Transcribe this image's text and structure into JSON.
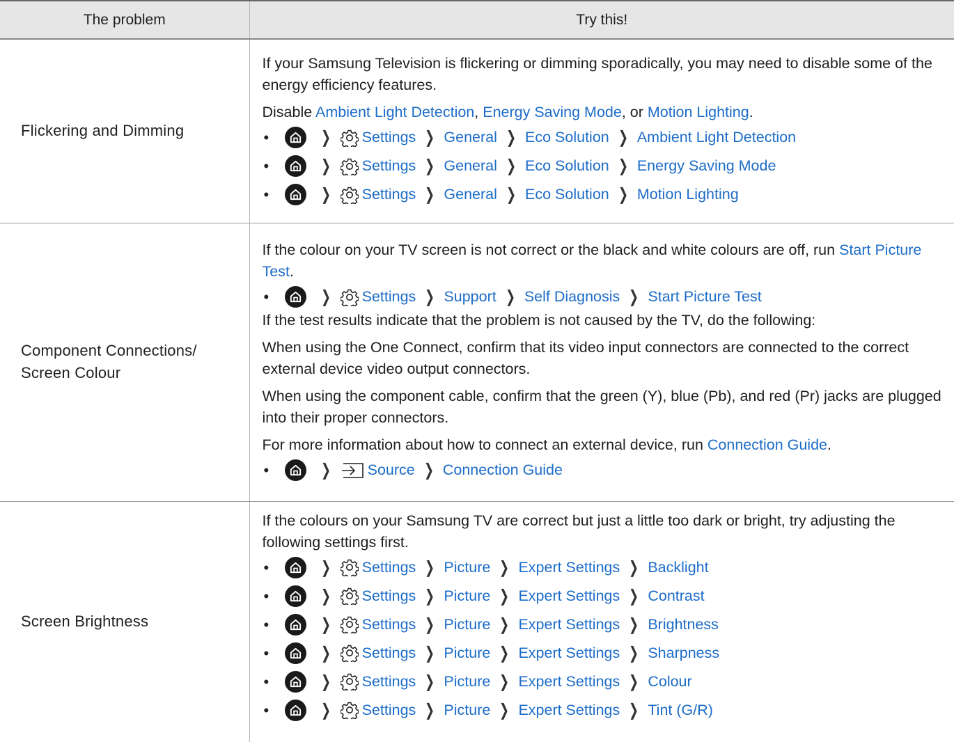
{
  "table": {
    "headers": [
      "The problem",
      "Try this!"
    ],
    "rows": [
      {
        "problem": "Flickering and Dimming",
        "p1": "If your Samsung Television is flickering or dimming sporadically, you may need to disable some of the energy efficiency features.",
        "p2_prefix": "Disable ",
        "p2_link1": "Ambient Light Detection",
        "p2_sep1": ", ",
        "p2_link2": "Energy Saving Mode",
        "p2_sep2": ", or ",
        "p2_link3": "Motion Lighting",
        "p2_end": ".",
        "paths": [
          [
            "Settings",
            "General",
            "Eco Solution",
            "Ambient Light Detection"
          ],
          [
            "Settings",
            "General",
            "Eco Solution",
            "Energy Saving Mode"
          ],
          [
            "Settings",
            "General",
            "Eco Solution",
            "Motion Lighting"
          ]
        ]
      },
      {
        "problem_line1": "Component Connections/",
        "problem_line2": "Screen Colour",
        "p1_text": "If the colour on your TV screen is not correct or the black and white colours are off, run ",
        "p1_link": "Start Picture Test",
        "p1_end": ".",
        "path1": [
          "Settings",
          "Support",
          "Self Diagnosis",
          "Start Picture Test"
        ],
        "p2": "If the test results indicate that the problem is not caused by the TV, do the following:",
        "p3": "When using the One Connect, confirm that its video input connectors are connected to the correct external device video output connectors.",
        "p4": "When using the component cable, confirm that the green (Y), blue (Pb), and red (Pr) jacks are plugged into their proper connectors.",
        "p5_text": "For more information about how to connect an external device, run ",
        "p5_link": "Connection Guide",
        "p5_end": ".",
        "path2": [
          "Source",
          "Connection Guide"
        ]
      },
      {
        "problem": "Screen Brightness",
        "p1": "If the colours on your Samsung TV are correct but just a little too dark or bright, try adjusting the following settings first.",
        "paths": [
          [
            "Settings",
            "Picture",
            "Expert Settings",
            "Backlight"
          ],
          [
            "Settings",
            "Picture",
            "Expert Settings",
            "Contrast"
          ],
          [
            "Settings",
            "Picture",
            "Expert Settings",
            "Brightness"
          ],
          [
            "Settings",
            "Picture",
            "Expert Settings",
            "Sharpness"
          ],
          [
            "Settings",
            "Picture",
            "Expert Settings",
            "Colour"
          ],
          [
            "Settings",
            "Picture",
            "Expert Settings",
            "Tint (G/R)"
          ]
        ]
      }
    ]
  },
  "icons": {
    "home": "home-icon",
    "settings": "gear-icon",
    "source": "source-icon",
    "separator": "chevron-right-icon"
  },
  "colors": {
    "link": "#1c6cc8",
    "header_bg": "#e6e6e6"
  }
}
